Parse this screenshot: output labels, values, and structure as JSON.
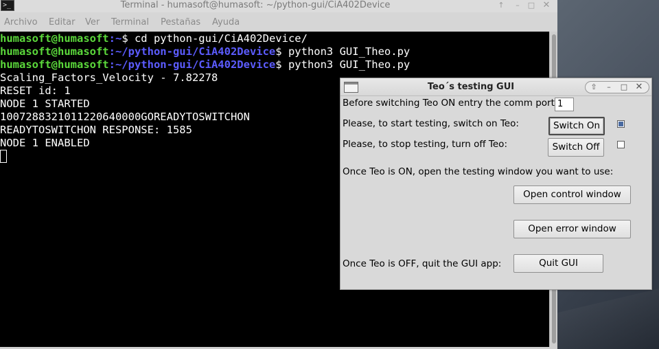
{
  "terminal": {
    "title": "Terminal - humasoft@humasoft: ~/python-gui/CiA402Device",
    "icon": "terminal-icon",
    "window_buttons": [
      "↑",
      "–",
      "□",
      "✕"
    ],
    "menu": [
      "Archivo",
      "Editar",
      "Ver",
      "Terminal",
      "Pestañas",
      "Ayuda"
    ],
    "prompt_user": "humasoft@humasoft",
    "lines": [
      {
        "path": ":~",
        "cmd": "$ cd python-gui/CiA402Device/"
      },
      {
        "path": ":~/python-gui/CiA402Device",
        "cmd": "$ python3 GUI_Theo.py"
      },
      {
        "path": ":~/python-gui/CiA402Device",
        "cmd": "$ python3 GUI_Theo.py"
      }
    ],
    "output": [
      "Scaling_Factors_Velocity - 7.82278",
      "RESET id: 1",
      "NODE 1 STARTED",
      "1007288321011220640000GOREADYTOSWITCHON",
      "READYTOSWITCHON RESPONSE: 1585",
      "NODE 1 ENABLED"
    ]
  },
  "dialog": {
    "title": "Teo´s testing GUI",
    "window_buttons": [
      "⇧",
      "–",
      "□",
      "✕"
    ],
    "comm_port_label": "Before switching Teo ON entry the comm port:",
    "comm_port_value": "1",
    "start_label": "Please, to start testing, switch on Teo:",
    "switch_on_button": "Switch On",
    "switch_on_checked": true,
    "stop_label": "Please, to stop testing, turn off Teo:",
    "switch_off_button": "Switch Off",
    "switch_off_checked": false,
    "open_label": "Once Teo is ON, open the testing window you want to use:",
    "open_control_button": "Open control window",
    "open_error_button": "Open error window",
    "quit_label": "Once Teo is OFF, quit the GUI app:",
    "quit_button": "Quit GUI"
  }
}
